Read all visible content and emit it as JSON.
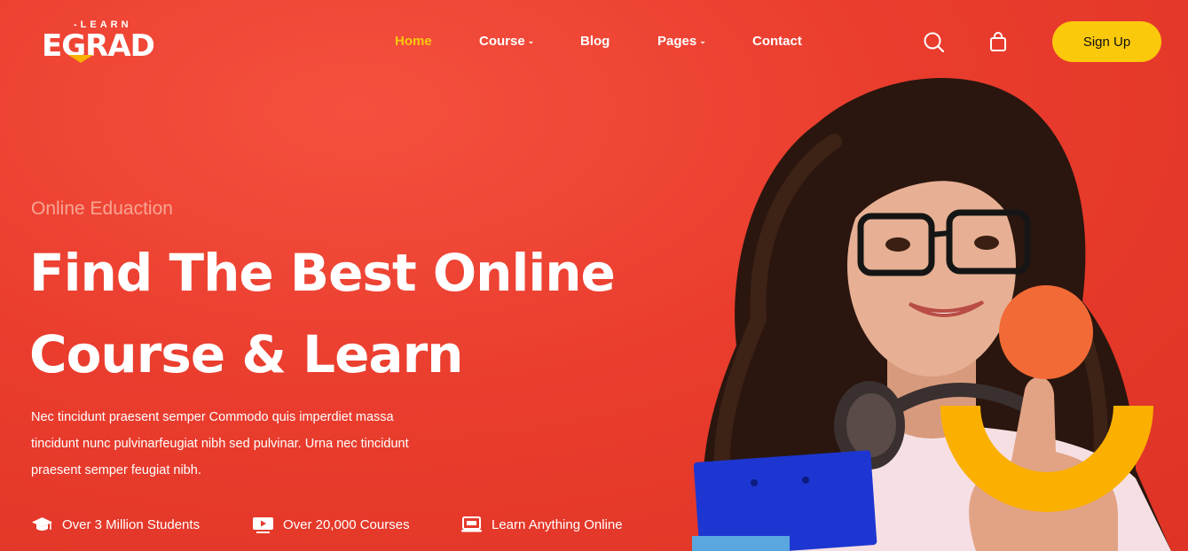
{
  "brand": {
    "logo_main": "EGRAD",
    "logo_sub": "-LEARN"
  },
  "nav": {
    "items": [
      {
        "label": "Home",
        "active": true,
        "dropdown": false
      },
      {
        "label": "Course",
        "active": false,
        "dropdown": true
      },
      {
        "label": "Blog",
        "active": false,
        "dropdown": false
      },
      {
        "label": "Pages",
        "active": false,
        "dropdown": true
      },
      {
        "label": "Contact",
        "active": false,
        "dropdown": false
      }
    ],
    "search_icon": "search-icon",
    "cart_icon": "shopping-bag-icon",
    "signup_label": "Sign Up"
  },
  "hero": {
    "eyebrow": "Online Eduaction",
    "headline_line1": "Find The Best Online",
    "headline_line2": "Course & Learn",
    "description_line1": "Nec tincidunt praesent semper Commodo quis imperdiet massa",
    "description_line2": "tincidunt nunc pulvinarfeugiat nibh sed pulvinar. Urna nec tincidunt",
    "description_line3": "praesent semper feugiat nibh.",
    "features": [
      {
        "icon": "graduation-cap-icon",
        "label": "Over 3 Million Students"
      },
      {
        "icon": "video-play-icon",
        "label": "Over 20,000 Courses"
      },
      {
        "icon": "laptop-icon",
        "label": "Learn Anything Online"
      }
    ]
  },
  "colors": {
    "background": "#e8392c",
    "accent_yellow": "#fbc90b",
    "active_nav": "#f9c80e",
    "orange_circle": "#f26a35",
    "yellow_arc": "#fbb000"
  }
}
